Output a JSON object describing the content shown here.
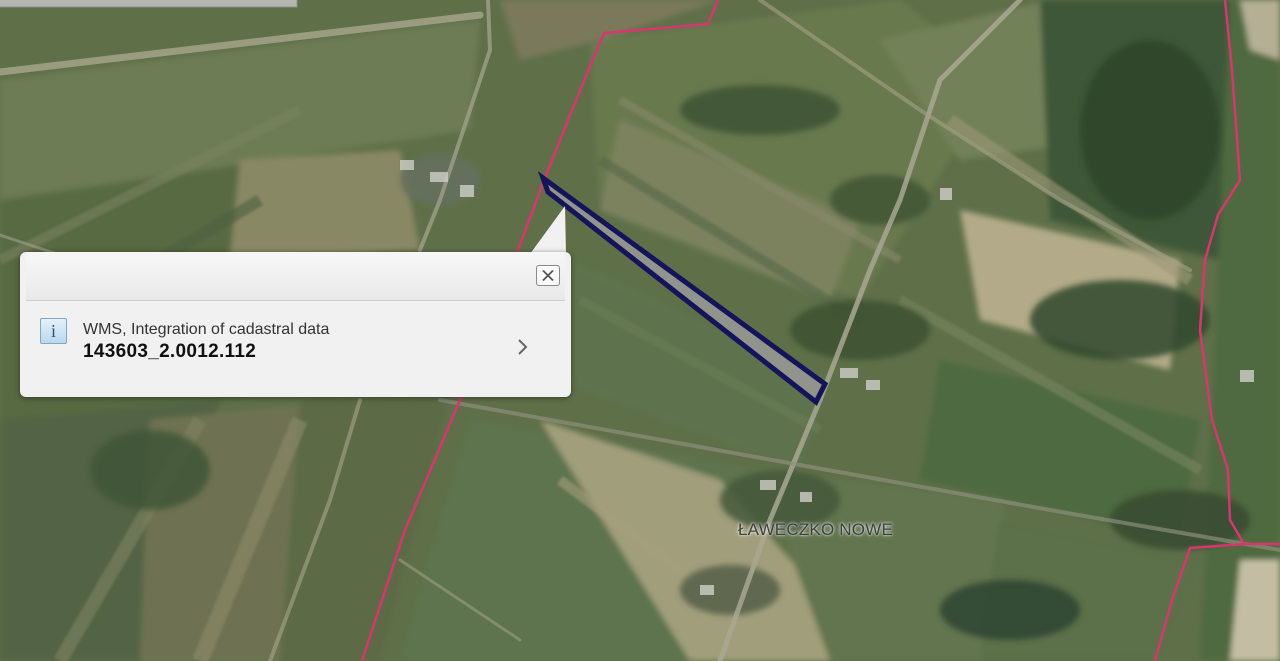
{
  "map": {
    "place_label": "ŁAWECZKO NOWE",
    "colors": {
      "boundary": "#d9356f",
      "parcel_outline": "#14145a",
      "parcel_fill": "#9a9a98"
    }
  },
  "popup": {
    "close_icon": "close-icon",
    "info_icon": "info-icon",
    "info_glyph": "i",
    "layer_name": "WMS, Integration of cadastral data",
    "feature_id": "143603_2.0012.112",
    "chevron_icon": "chevron-right-icon"
  }
}
